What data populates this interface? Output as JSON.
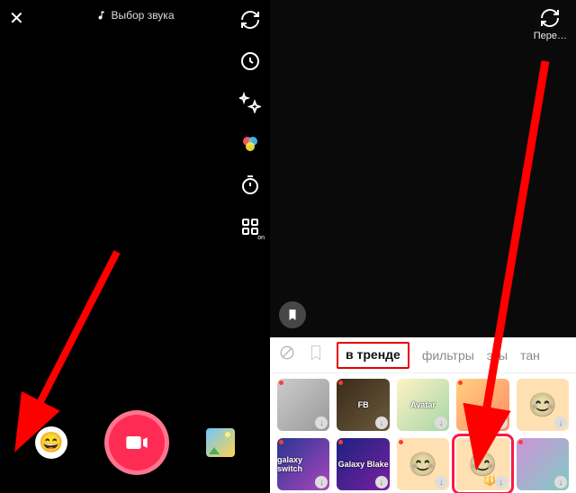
{
  "left": {
    "close": "✕",
    "sound_select": "Выбор звука",
    "tools": {
      "flip": "flip",
      "speed": "speed",
      "beauty": "beauty",
      "filters": "filters",
      "timer": "timer",
      "more": "more"
    }
  },
  "right": {
    "flip_label": "Пере…",
    "tabs": {
      "none": "none",
      "bookmark": "bookmark",
      "trending": "в тренде",
      "filters": "фильтры",
      "effects_partial": "эты",
      "dance_partial": "тан"
    },
    "effects": [
      {
        "label": "",
        "new": true,
        "has_download": true,
        "bg": "linear-gradient(135deg,#ccc,#999)"
      },
      {
        "label": "FB",
        "new": true,
        "has_download": true,
        "bg": "linear-gradient(135deg,#3a2a1a,#6b5b3b)"
      },
      {
        "label": "Avatar",
        "new": false,
        "has_download": true,
        "bg": "linear-gradient(135deg,#fff3c4,#a5d6a7)"
      },
      {
        "label": "",
        "new": true,
        "has_download": true,
        "bg": "linear-gradient(135deg,#ffd180,#ff8a65)"
      },
      {
        "label": "",
        "new": false,
        "has_download": true,
        "bg": "#ffe0b2",
        "face": true
      },
      {
        "label": "galaxy switch",
        "new": true,
        "has_download": true,
        "bg": "linear-gradient(135deg,#283593,#ab47bc)"
      },
      {
        "label": "Galaxy Blake",
        "new": true,
        "has_download": true,
        "bg": "linear-gradient(135deg,#1a237e,#7b1fa2)"
      },
      {
        "label": "",
        "new": true,
        "has_download": true,
        "bg": "#ffe0b2",
        "face": true
      },
      {
        "label": "",
        "new": false,
        "has_download": true,
        "bg": "#ffe0b2",
        "face": true,
        "highlight": true,
        "trident": true
      },
      {
        "label": "",
        "new": true,
        "has_download": true,
        "bg": "linear-gradient(135deg,#ce93d8,#80cbc4)"
      }
    ]
  }
}
